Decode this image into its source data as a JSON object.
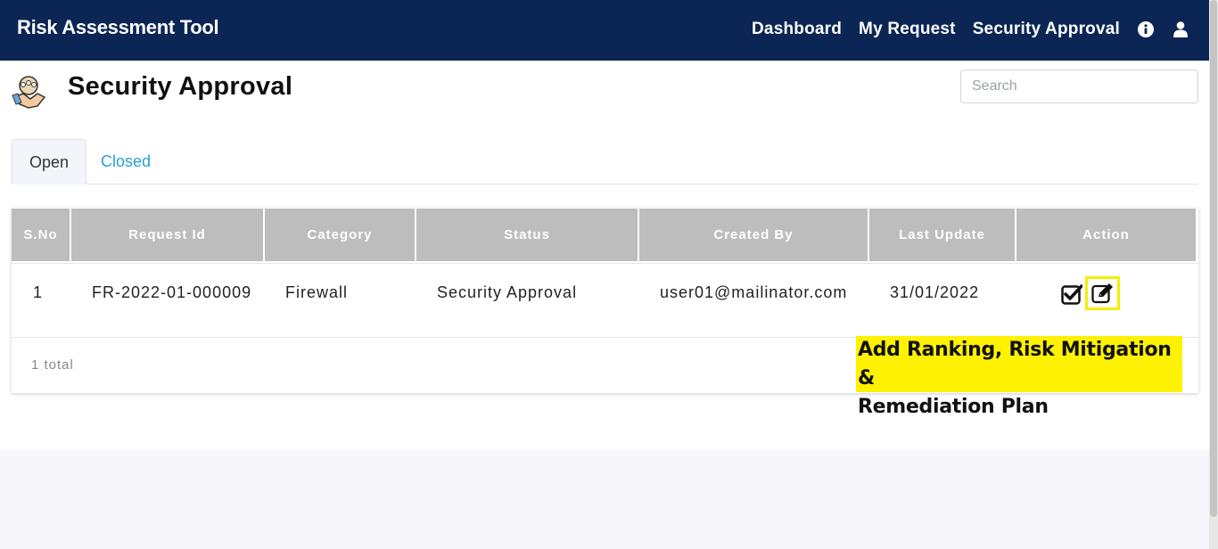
{
  "navbar": {
    "brand": "Risk Assessment Tool",
    "links": [
      "Dashboard",
      "My Request",
      "Security Approval"
    ],
    "icons": [
      "info-icon",
      "user-icon"
    ]
  },
  "page": {
    "title": "Security Approval",
    "icon": "handshake-team-icon"
  },
  "search": {
    "placeholder": "Search",
    "value": ""
  },
  "tabs": [
    {
      "label": "Open",
      "active": true
    },
    {
      "label": "Closed",
      "active": false
    }
  ],
  "table": {
    "columns": [
      "S.No",
      "Request Id",
      "Category",
      "Status",
      "Created By",
      "Last Update",
      "Action"
    ],
    "rows": [
      {
        "sno": "1",
        "request_id": "FR-2022-01-000009",
        "category": "Firewall",
        "status": "Security Approval",
        "created_by": "user01@mailinator.com",
        "last_update": "31/01/2022",
        "actions": [
          "checkbox-check-icon",
          "edit-icon"
        ]
      }
    ],
    "total": "1 total"
  },
  "annotation": {
    "line1": "Add Ranking, Risk Mitigation &",
    "line2": "Remediation Plan",
    "color": "#fff200"
  },
  "colors": {
    "navbar": "#0b2654",
    "header_cell": "#bdbdbd",
    "tab_link": "#2a9fd6",
    "highlight": "#f5ef00"
  }
}
